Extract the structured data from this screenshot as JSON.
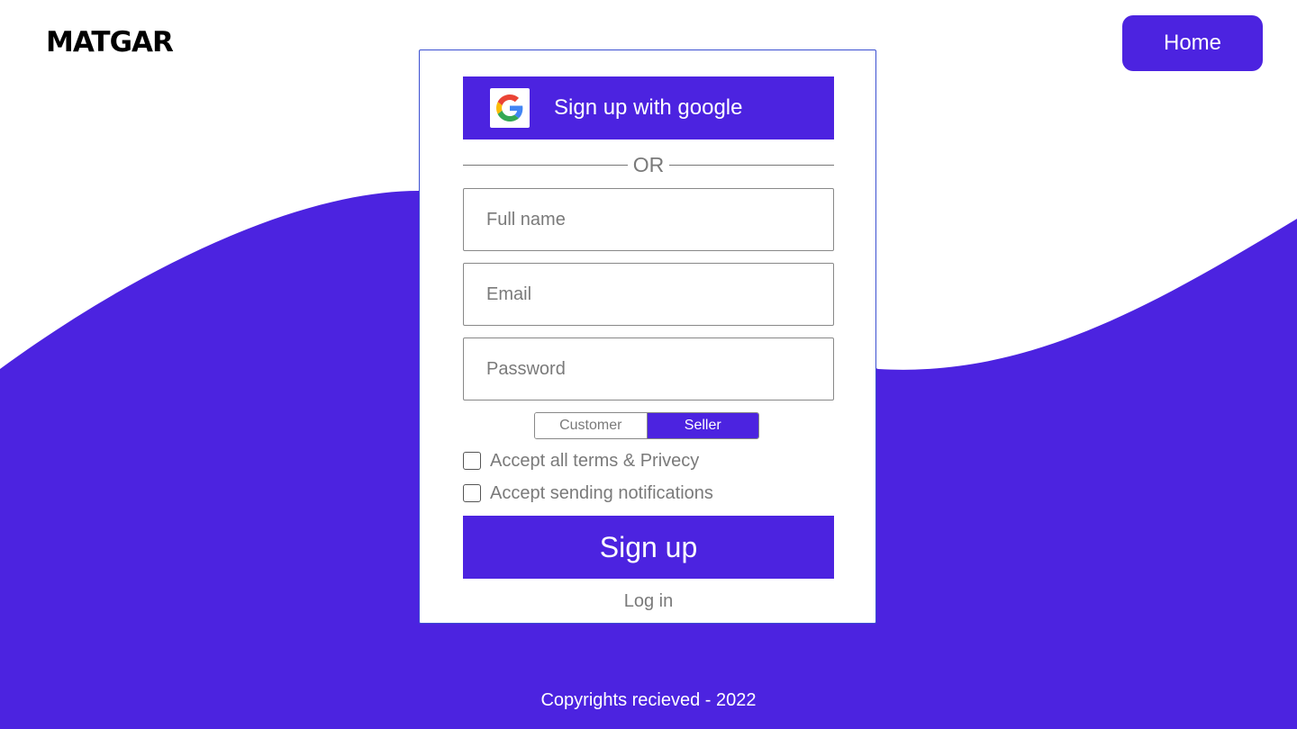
{
  "brand": {
    "logo_text": "MATGAR"
  },
  "header": {
    "home_label": "Home"
  },
  "signup_card": {
    "google_button_label": "Sign up with google",
    "divider_text": "OR",
    "fields": [
      {
        "placeholder": "Full name",
        "value": ""
      },
      {
        "placeholder": "Email",
        "value": ""
      },
      {
        "placeholder": "Password",
        "value": ""
      }
    ],
    "role_toggle": {
      "options": [
        "Customer",
        "Seller"
      ],
      "selected": "Seller"
    },
    "checkboxes": [
      {
        "label": "Accept all terms & Privecy",
        "checked": false
      },
      {
        "label": "Accept sending notifications",
        "checked": false
      }
    ],
    "signup_button_label": "Sign up",
    "login_link_label": "Log in"
  },
  "footer": {
    "copyright": "Copyrights recieved - 2022"
  },
  "colors": {
    "accent": "#4c23e0",
    "card_border": "#3b4fd1",
    "muted_text": "#7a7a7a",
    "background": "#ffffff"
  },
  "icons": {
    "google": "google-g-icon"
  }
}
